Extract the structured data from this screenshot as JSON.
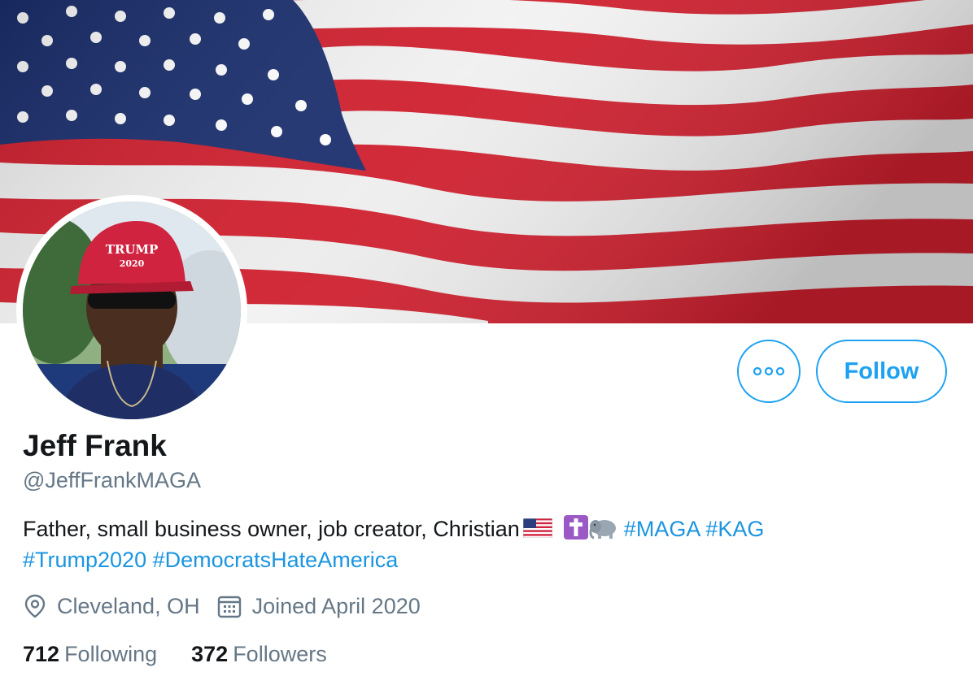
{
  "profile": {
    "name": "Jeff Frank",
    "handle": "@JeffFrankMAGA",
    "bio_text": "Father, small business owner, job creator, Christian",
    "bio_emojis": [
      "us-flag",
      "latin-cross",
      "elephant"
    ],
    "hashtags": [
      "#MAGA",
      "#KAG",
      "#Trump2020",
      "#DemocratsHateAmerica"
    ],
    "location": "Cleveland, OH",
    "joined": "Joined April 2020",
    "following_count": "712",
    "following_label": "Following",
    "followers_count": "372",
    "followers_label": "Followers",
    "hat_text_line1": "TRUMP",
    "hat_text_line2": "2020"
  },
  "actions": {
    "follow_label": "Follow",
    "more_icon": "more-horizontal-icon"
  },
  "icons": {
    "location": "location-pin-icon",
    "calendar": "calendar-icon"
  },
  "colors": {
    "accent": "#1da1f2",
    "hashtag": "#1b95e0",
    "secondary_text": "#657786",
    "primary_text": "#14171a"
  }
}
